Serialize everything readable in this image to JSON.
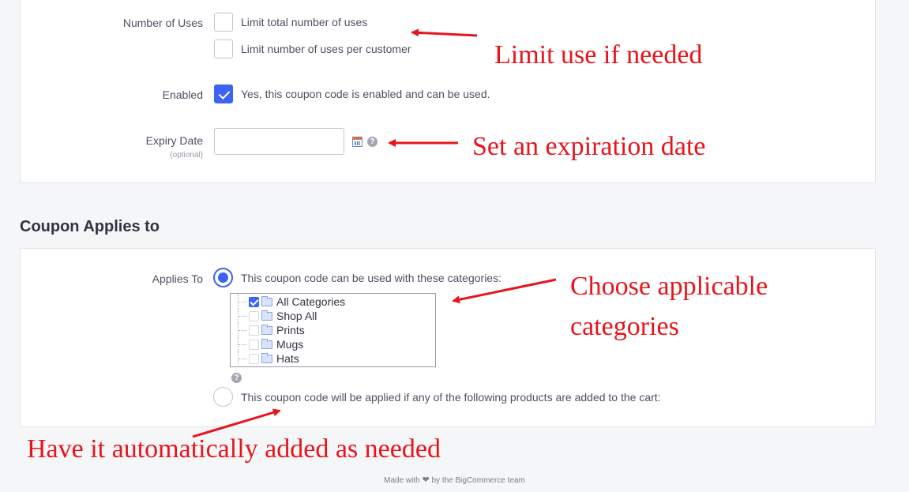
{
  "usage": {
    "label": "Number of Uses",
    "limit_total": {
      "text": "Limit total number of uses",
      "checked": false
    },
    "limit_per_customer": {
      "text": "Limit number of uses per customer",
      "checked": false
    }
  },
  "enabled": {
    "label": "Enabled",
    "text": "Yes, this coupon code is enabled and can be used.",
    "checked": true
  },
  "expiry": {
    "label": "Expiry Date",
    "sublabel": "(optional)",
    "value": "",
    "calendar_icon": "calendar-icon",
    "help_icon": "help-icon",
    "help_glyph": "?"
  },
  "applies_section": {
    "title": "Coupon Applies to",
    "label": "Applies To",
    "option_categories": {
      "text": "This coupon code can be used with these categories:",
      "selected": true
    },
    "categories": [
      {
        "name": "All Categories",
        "checked": true
      },
      {
        "name": "Shop All",
        "checked": false
      },
      {
        "name": "Prints",
        "checked": false
      },
      {
        "name": "Mugs",
        "checked": false
      },
      {
        "name": "Hats",
        "checked": false
      }
    ],
    "help_glyph": "?",
    "option_products": {
      "text": "This coupon code will be applied if any of the following products are added to the cart:",
      "selected": false
    }
  },
  "annotations": {
    "limit_use": "Limit use if needed",
    "expiration": "Set an expiration date",
    "categories_line1": "Choose applicable",
    "categories_line2": "categories",
    "auto_add": "Have it automatically added as needed",
    "color": "#e8141c"
  },
  "footer": {
    "prefix": "Made with",
    "heart": "❤",
    "suffix": "by the BigCommerce team"
  },
  "colors": {
    "accent": "#3c64f4",
    "background": "#f5f6f8",
    "panel": "#ffffff"
  }
}
